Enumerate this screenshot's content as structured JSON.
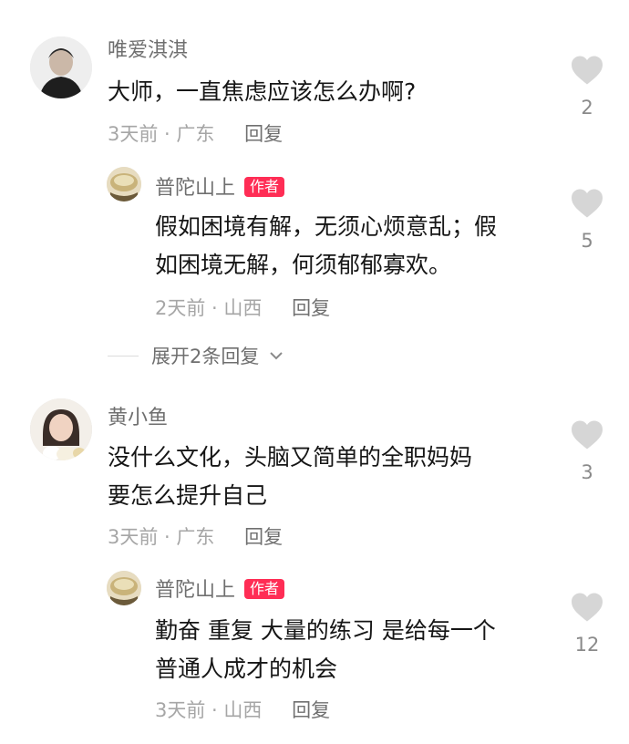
{
  "comments": [
    {
      "author": "唯爱淇淇",
      "text": "大师，一直焦虑应该怎么办啊?",
      "time": "3天前",
      "location": "广东",
      "reply_label": "回复",
      "likes": "2",
      "reply": {
        "author": "普陀山上",
        "badge": "作者",
        "line1": "假如困境有解，无须心烦意乱；假",
        "line2": "如困境无解，何须郁郁寡欢。",
        "time": "2天前",
        "location": "山西",
        "reply_label": "回复",
        "likes": "5"
      },
      "expand_label": "展开2条回复"
    },
    {
      "author": "黄小鱼",
      "line1": "没什么文化，头脑又简单的全职妈妈",
      "line2": "要怎么提升自己",
      "time": "3天前",
      "location": "广东",
      "reply_label": "回复",
      "likes": "3",
      "reply": {
        "author": "普陀山上",
        "badge": "作者",
        "line1": "勤奋 重复 大量的练习 是给每一个",
        "line2": "普通人成才的机会",
        "time": "3天前",
        "location": "山西",
        "reply_label": "回复",
        "likes": "12"
      }
    }
  ],
  "separator": " · ",
  "icons": {
    "like": "heart-icon",
    "expand": "chevron-down-icon"
  },
  "colors": {
    "badge": "#ff2d55",
    "heart": "#d6d6d6"
  }
}
